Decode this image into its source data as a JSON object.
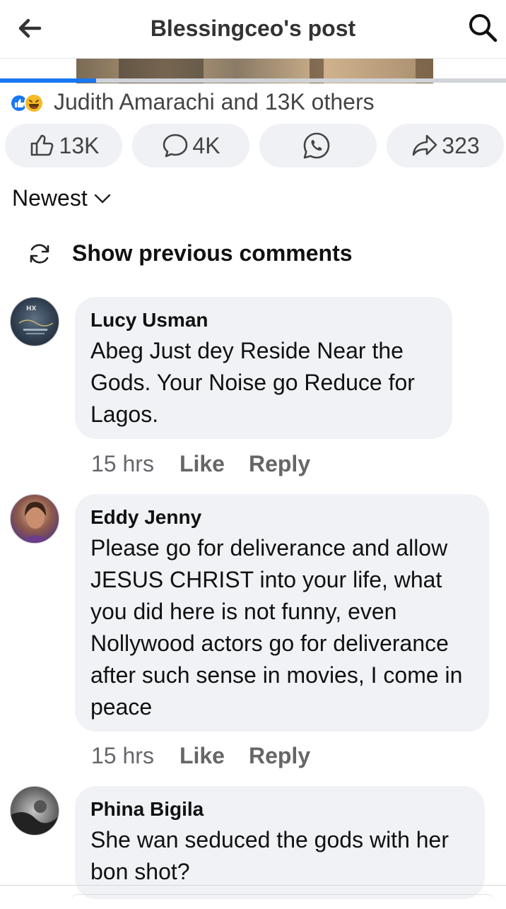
{
  "header": {
    "title": "Blessingceo's post",
    "back_icon": "arrow-left-icon",
    "search_icon": "search-icon"
  },
  "media": {
    "progress_fraction": 0.19,
    "accent": "#1877f2"
  },
  "reactions": {
    "summary_text": "Judith Amarachi and 13K others",
    "icons": [
      "like-reaction-icon",
      "haha-reaction-icon"
    ]
  },
  "actions": {
    "like_count": "13K",
    "comment_count": "4K",
    "share_count": "323"
  },
  "sort": {
    "label": "Newest"
  },
  "show_previous": {
    "label": "Show previous comments"
  },
  "comments": [
    {
      "author": "Lucy Usman",
      "text": "Abeg Just dey Reside Near the Gods.  Your Noise go Reduce for Lagos.",
      "time": "15 hrs",
      "like": "Like",
      "reply": "Reply"
    },
    {
      "author": "Eddy Jenny",
      "text": "Please go for deliverance and allow JESUS CHRIST into your life, what you did here is not funny, even Nollywood actors go for deliverance after such sense in movies, I come in peace",
      "time": "15 hrs",
      "like": "Like",
      "reply": "Reply"
    },
    {
      "author": "Phina Bigila",
      "text": "She wan seduced the gods with her bon shot?"
    }
  ]
}
